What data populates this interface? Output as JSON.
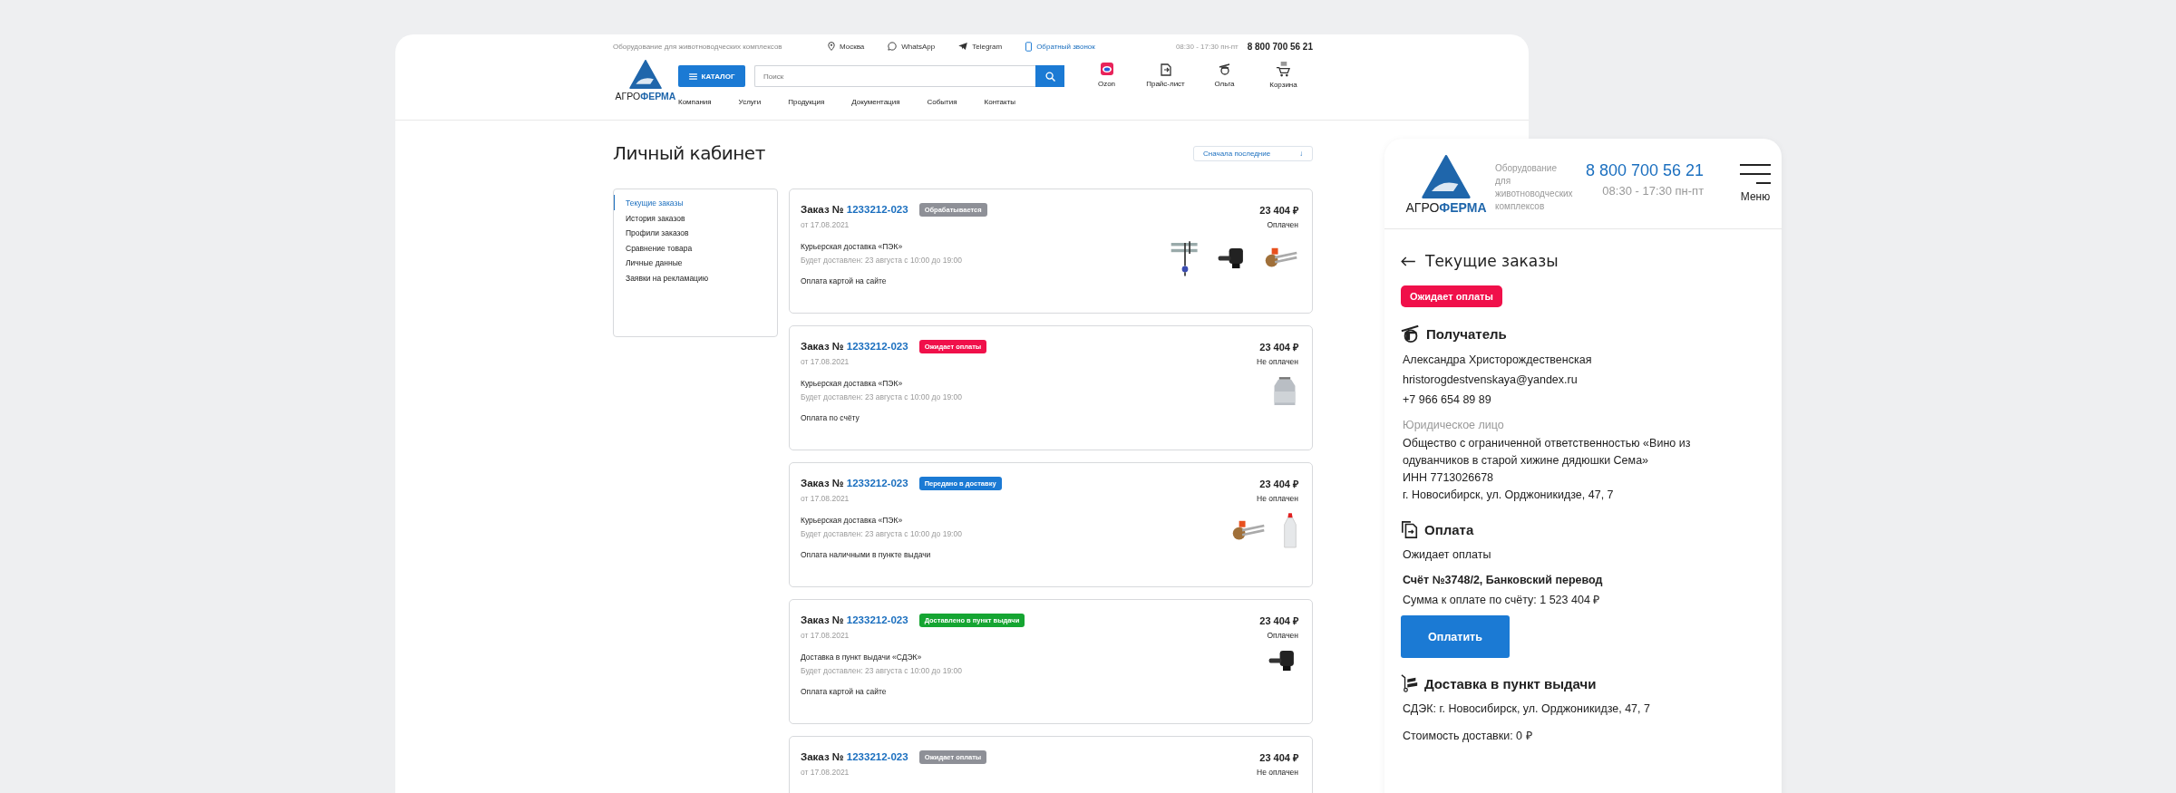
{
  "desktop": {
    "topbar": {
      "tagline": "Оборудование для животноводческих комплексов",
      "city": "Москва",
      "whatsapp": "WhatsApp",
      "telegram": "Telegram",
      "callback": "Обратный звонок",
      "hours": "08:30 - 17:30 пн-пт",
      "phone": "8 800 700 56 21"
    },
    "logo": {
      "word_1": "АГРО",
      "word_2": "ФЕРМА"
    },
    "catalog_button": "КАТАЛОГ",
    "search": {
      "placeholder": "Поиск"
    },
    "header_links": [
      {
        "kind": "ozon",
        "label": "Ozon"
      },
      {
        "kind": "price",
        "label": "Прайс-лист"
      },
      {
        "kind": "user",
        "label": "Ольга"
      },
      {
        "kind": "cart",
        "label": "Корзина"
      }
    ],
    "nav": [
      "Компания",
      "Услуги",
      "Продукция",
      "Документация",
      "События",
      "Контакты"
    ],
    "title": "Личный кабинет",
    "sort": {
      "label": "Сначала последние",
      "arrow": "↓"
    },
    "sidebar": [
      {
        "label": "Текущие заказы",
        "selected": true
      },
      {
        "label": "История заказов",
        "selected": false
      },
      {
        "label": "Профили заказов",
        "selected": false
      },
      {
        "label": "Сравнение товара",
        "selected": false
      },
      {
        "label": "Личные данные",
        "selected": false
      },
      {
        "label": "Заявки на рекламацию",
        "selected": false
      }
    ],
    "orders": [
      {
        "prefix": "Заказ №",
        "number": "1233212-023",
        "status": "Обрабатывается",
        "color": "#8e9097",
        "date": "от 17.08.2021",
        "delivery": "Курьерская доставка «ПЭК»",
        "eta": "Будет доставлен: 23 августа с 10:00 до 19:00",
        "payment": "Оплата картой на сайте",
        "price": "23 404 ₽",
        "paid": "Оплачен",
        "products": [
          {
            "kind": "milker"
          },
          {
            "kind": "pump"
          },
          {
            "kind": "heater"
          }
        ]
      },
      {
        "prefix": "Заказ №",
        "number": "1233212-023",
        "status": "Ожидает оплаты",
        "color": "#f0104a",
        "date": "от 17.08.2021",
        "delivery": "Курьерская доставка «ПЭК»",
        "eta": "Будет доставлен: 23 августа с 10:00 до 19:00",
        "payment": "Оплата по счёту",
        "price": "23 404 ₽",
        "paid": "Не оплачен",
        "products": [
          {
            "kind": "can"
          }
        ]
      },
      {
        "prefix": "Заказ №",
        "number": "1233212-023",
        "status": "Передано в доставку",
        "color": "#1b7ad4",
        "date": "от 17.08.2021",
        "delivery": "Курьерская доставка «ПЭК»",
        "eta": "Будет доставлен: 23 августа с 10:00 до 19:00",
        "payment": "Оплата наличными в пункте выдачи",
        "price": "23 404 ₽",
        "paid": "Не оплачен",
        "products": [
          {
            "kind": "heater"
          },
          {
            "kind": "bottle"
          }
        ]
      },
      {
        "prefix": "Заказ №",
        "number": "1233212-023",
        "status": "Доставлено в пункт выдачи",
        "color": "#15a532",
        "date": "от 17.08.2021",
        "delivery": "Доставка в пункт выдачи «СДЭК»",
        "eta": "Будет доставлен: 23 августа с 10:00 до 19:00",
        "payment": "Оплата картой на сайте",
        "price": "23 404 ₽",
        "paid": "Оплачен",
        "products": [
          {
            "kind": "pump"
          }
        ]
      },
      {
        "prefix": "Заказ №",
        "number": "1233212-023",
        "status": "Ожидает оплаты",
        "color": "#8e9097",
        "date": "от 17.08.2021",
        "price": "23 404 ₽",
        "paid": "Не оплачен"
      }
    ]
  },
  "mobile": {
    "logo": {
      "word_1": "АГРО",
      "word_2": "ФЕРМА"
    },
    "tagline": "Оборудование для животноводческих комплексов",
    "phone": "8 800 700 56 21",
    "hours": "08:30 - 17:30 пн-пт",
    "menu": "Меню",
    "back_title": "Текущие заказы",
    "status": {
      "label": "Ожидает оплаты",
      "color": "#f0104a"
    },
    "recipient": {
      "heading": "Получатель",
      "name": "Александра Христорождественская",
      "email": "hristorogdestvenskaya@yandex.ru",
      "phone": "+7 966 654 89 89",
      "legal_label": "Юридическое лицо",
      "company": "Общество с ограниченной ответственностью «Вино из одуванчиков в старой хижине дядюшки Сема»",
      "inn": "ИНН 7713026678",
      "address": "г. Новосибирск, ул. Орджоникидзе, 47, 7"
    },
    "payment": {
      "heading": "Оплата",
      "state": "Ожидает оплаты",
      "invoice": "Счёт №3748/2, Банковский перевод",
      "sum": "Сумма к оплате по счёту: 1 523 404 ₽",
      "button": "Оплатить"
    },
    "delivery": {
      "heading": "Доставка в пункт выдачи",
      "address": "СДЭК: г. Новосибирск, ул. Орджоникидзе, 47, 7",
      "cost": "Стоимость доставки: 0 ₽"
    }
  }
}
